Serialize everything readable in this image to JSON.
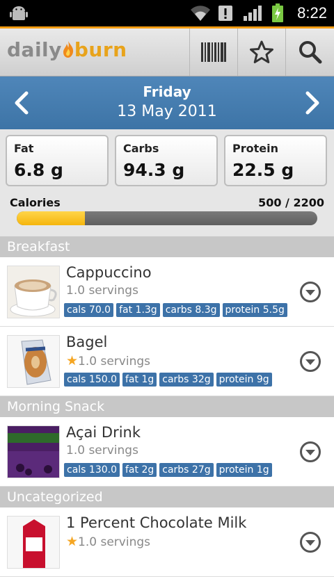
{
  "status_bar": {
    "time": "8:22"
  },
  "header": {
    "logo_daily": "daily",
    "logo_burn": "burn"
  },
  "date_nav": {
    "day": "Friday",
    "date": "13 May 2011"
  },
  "macros": {
    "fat": {
      "label": "Fat",
      "value": "6.8 g"
    },
    "carbs": {
      "label": "Carbs",
      "value": "94.3 g"
    },
    "protein": {
      "label": "Protein",
      "value": "22.5 g"
    }
  },
  "calories": {
    "label": "Calories",
    "value": "500 / 2200",
    "progress": 0.227
  },
  "sections": [
    {
      "title": "Breakfast",
      "items": [
        {
          "name": "Cappuccino",
          "servings": "1.0 servings",
          "favorite": false,
          "tags": [
            "cals 70.0",
            "fat 1.3g",
            "carbs 8.3g",
            "protein 5.5g"
          ]
        },
        {
          "name": "Bagel",
          "servings": "1.0 servings",
          "favorite": true,
          "tags": [
            "cals 150.0",
            "fat 1g",
            "carbs 32g",
            "protein 9g"
          ]
        }
      ]
    },
    {
      "title": "Morning Snack",
      "items": [
        {
          "name": "Açai Drink",
          "servings": "1.0 servings",
          "favorite": false,
          "tags": [
            "cals 130.0",
            "fat 2g",
            "carbs 27g",
            "protein 1g"
          ]
        }
      ]
    },
    {
      "title": "Uncategorized",
      "items": [
        {
          "name": "1 Percent Chocolate Milk",
          "servings": "1.0 servings",
          "favorite": true,
          "tags": []
        }
      ]
    }
  ],
  "colors": {
    "accent": "#f39c12",
    "tag_blue": "#3d72a8",
    "date_bar": "#4f86b9",
    "progress_fill": "#f5b50c"
  }
}
